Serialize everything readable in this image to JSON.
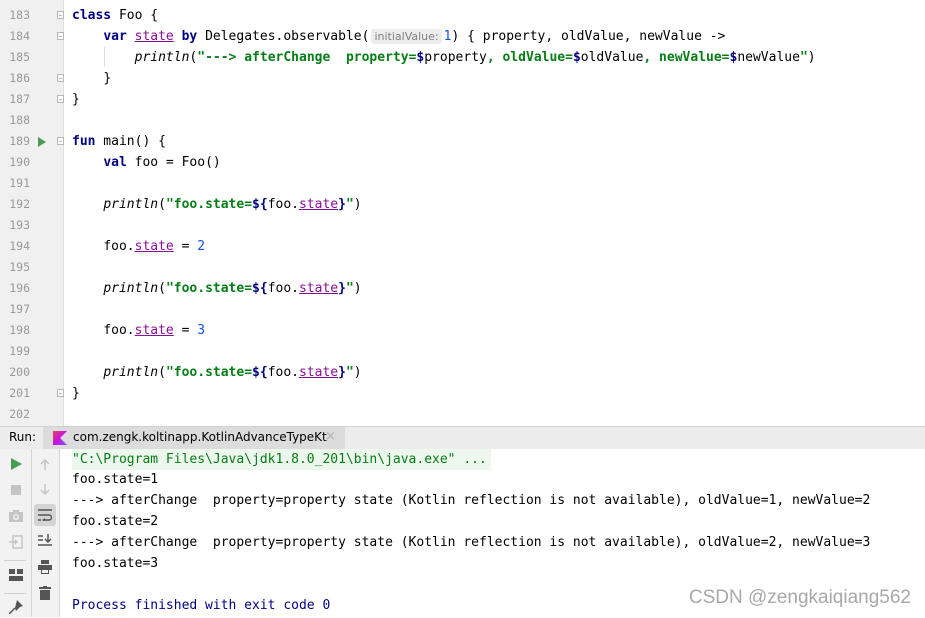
{
  "editor": {
    "line_numbers": [
      "183",
      "184",
      "185",
      "186",
      "187",
      "188",
      "189",
      "190",
      "191",
      "192",
      "193",
      "194",
      "195",
      "196",
      "197",
      "198",
      "199",
      "200",
      "201",
      "202"
    ],
    "lines": {
      "l183": {
        "kw": "class",
        "rest": " Foo {"
      },
      "l184": {
        "kw1": "var",
        "prop": "state",
        "kw2": "by",
        "text1": " Delegates.observable(",
        "hint": "initialValue:",
        "num": "1",
        "text2": ") { property, oldValue, newValue ->"
      },
      "l185": {
        "fn": "println",
        "open": "(",
        "str": "\"---> afterChange  property=",
        "d1": "$",
        "t1": "property",
        "s2": ", oldValue=",
        "d2": "$",
        "t2": "oldValue",
        "s3": ", newValue=",
        "d3": "$",
        "t3": "newValue",
        "s4": "\"",
        "close": ")"
      },
      "l186": {
        "text": "}"
      },
      "l187": {
        "text": "}"
      },
      "l189": {
        "kw": "fun",
        "rest": " main() {"
      },
      "l190": {
        "kw": "val",
        "rest": " foo = Foo()"
      },
      "l192": {
        "fn": "println",
        "open": "(",
        "str1": "\"foo.state=",
        "d": "${",
        "t1": "foo.",
        "prop": "state",
        "d2": "}",
        "str2": "\"",
        "close": ")"
      },
      "l194": {
        "t1": "foo.",
        "prop": "state",
        "t2": " = ",
        "num": "2"
      },
      "l196": {
        "fn": "println",
        "open": "(",
        "str1": "\"foo.state=",
        "d": "${",
        "t1": "foo.",
        "prop": "state",
        "d2": "}",
        "str2": "\"",
        "close": ")"
      },
      "l198": {
        "t1": "foo.",
        "prop": "state",
        "t2": " = ",
        "num": "3"
      },
      "l200": {
        "fn": "println",
        "open": "(",
        "str1": "\"foo.state=",
        "d": "${",
        "t1": "foo.",
        "prop": "state",
        "d2": "}",
        "str2": "\"",
        "close": ")"
      },
      "l201": {
        "text": "}"
      }
    }
  },
  "run_panel": {
    "label": "Run:",
    "tab_title": "com.zengk.koltinapp.KotlinAdvanceTypeKt",
    "tab_close": "×",
    "left_tools": [
      "rerun-icon",
      "stop-icon",
      "screenshot-icon",
      "exit-icon",
      "layout-icon",
      "pin-icon"
    ],
    "right_tools": [
      "up-arrow-icon",
      "down-arrow-icon",
      "soft-wrap-icon",
      "scroll-to-end-icon",
      "print-icon",
      "trash-icon"
    ],
    "console": [
      "\"C:\\Program Files\\Java\\jdk1.8.0_201\\bin\\java.exe\" ...",
      "foo.state=1",
      "---> afterChange  property=property state (Kotlin reflection is not available), oldValue=1, newValue=2",
      "foo.state=2",
      "---> afterChange  property=property state (Kotlin reflection is not available), oldValue=2, newValue=3",
      "foo.state=3",
      "",
      "Process finished with exit code 0"
    ]
  },
  "watermark": "CSDN @zengkaiqiang562",
  "colors": {
    "keyword": "#000080",
    "string": "#067d17",
    "number": "#1750eb",
    "property": "#871094",
    "run_green": "#499c54"
  }
}
